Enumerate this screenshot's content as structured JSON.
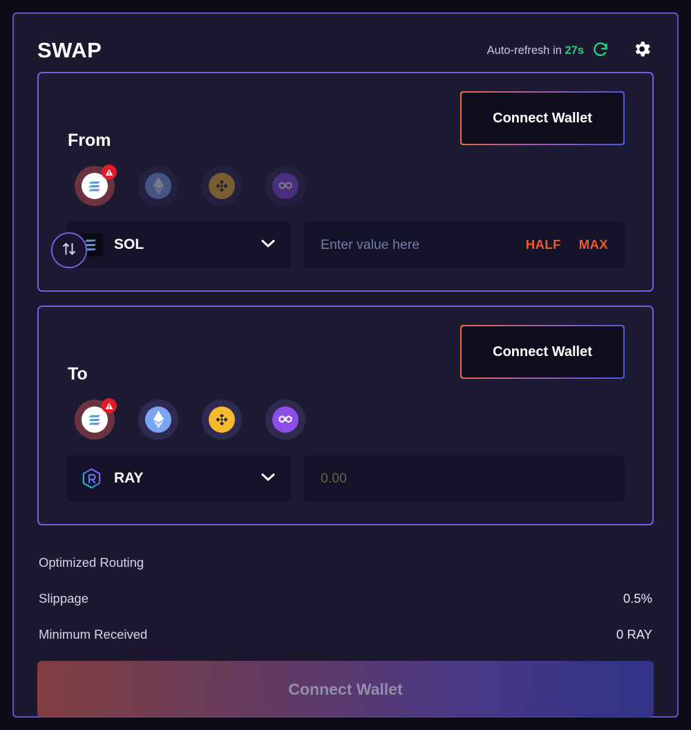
{
  "header": {
    "title": "SWAP",
    "refresh_prefix": "Auto-refresh in",
    "refresh_countdown": "27s",
    "refresh_icon": "refresh-circle-icon",
    "settings_icon": "gear-icon"
  },
  "from_section": {
    "label": "From",
    "connect_label": "Connect Wallet",
    "chains": [
      {
        "name": "solana",
        "label": "SOL",
        "selected": true,
        "warning": true
      },
      {
        "name": "ethereum",
        "label": "ETH",
        "selected": false,
        "warning": false
      },
      {
        "name": "bnb",
        "label": "BNB",
        "selected": false,
        "warning": false
      },
      {
        "name": "polygon",
        "label": "POLYGON",
        "selected": false,
        "warning": false
      }
    ],
    "token_symbol": "SOL",
    "amount_value": "",
    "amount_placeholder": "Enter value here",
    "half_label": "HALF",
    "max_label": "MAX"
  },
  "swap_toggle": {
    "icon": "swap-vertical-arrows-icon"
  },
  "to_section": {
    "label": "To",
    "connect_label": "Connect Wallet",
    "chains": [
      {
        "name": "solana",
        "label": "SOL",
        "selected": true,
        "warning": true
      },
      {
        "name": "ethereum",
        "label": "ETH",
        "selected": false,
        "warning": false
      },
      {
        "name": "bnb",
        "label": "BNB",
        "selected": false,
        "warning": false
      },
      {
        "name": "polygon",
        "label": "POLYGON",
        "selected": false,
        "warning": false
      }
    ],
    "token_symbol": "RAY",
    "amount_value": "",
    "amount_placeholder": "0.00"
  },
  "info": {
    "routing_label": "Optimized Routing",
    "routing_value": "",
    "slippage_label": "Slippage",
    "slippage_value": "0.5%",
    "minimum_label": "Minimum Received",
    "minimum_value": "0 RAY"
  },
  "cta": {
    "label": "Connect Wallet"
  },
  "colors": {
    "page_background": "#0c0c16",
    "card_background": "#1b1830",
    "card_border": "#6d4fd0",
    "panel_background": "#1d1a33",
    "panel_border": "#7c5ce0",
    "field_background": "#15132a",
    "accent_orange": "#f05a28",
    "accent_green": "#20d67b",
    "text_primary": "#ffffff",
    "text_muted": "#c9c6dc"
  }
}
